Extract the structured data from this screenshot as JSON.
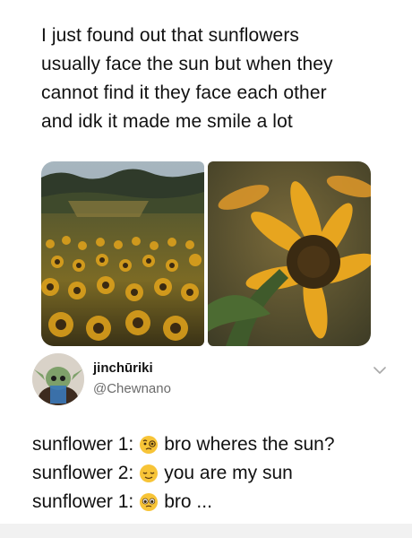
{
  "post": {
    "lines": [
      "I just found out that sunflowers",
      "usually face the sun but when they",
      "cannot find it they face each other",
      "and idk it made me smile a lot"
    ]
  },
  "images": {
    "left": {
      "subject": "sunflower-field"
    },
    "right": {
      "subject": "sunflower-closeup"
    }
  },
  "tweet": {
    "display_name": "jinchūriki",
    "handle": "@Chewnano",
    "lines": [
      {
        "speaker": "sunflower 1:",
        "emoji": "face-with-monocle",
        "text": "bro wheres the sun?"
      },
      {
        "speaker": "sunflower 2:",
        "emoji": "relieved-face",
        "text": "you are my sun"
      },
      {
        "speaker": "sunflower 1:",
        "emoji": "pleading-face",
        "text": "bro ..."
      }
    ]
  },
  "colors": {
    "text": "#111111",
    "muted": "#6b6b6b",
    "emoji_yellow": "#f7c437"
  }
}
